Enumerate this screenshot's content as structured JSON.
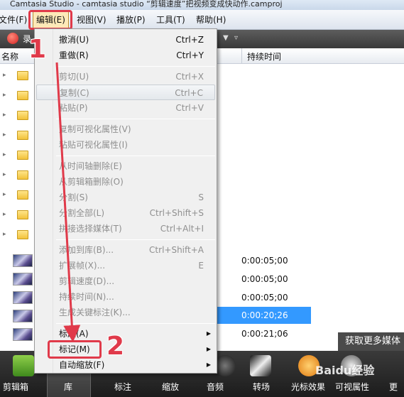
{
  "window": {
    "title": "Camtasia Studio - camtasia studio “剪辑速度”把视频变成快动作.camproj"
  },
  "menubar": {
    "file": "文件(F)",
    "edit": "编辑(E)",
    "view": "视图(V)",
    "play": "播放(P)",
    "tools": "工具(T)",
    "help": "帮助(H)"
  },
  "toolbar": {
    "record_label": "录"
  },
  "column_headers": {
    "name": "名称",
    "duration": "持续时间"
  },
  "clips": [
    {
      "duration": "0:00:05;00"
    },
    {
      "duration": "0:00:05;00"
    },
    {
      "duration": "0:00:05;00"
    },
    {
      "duration": "0:00:20;26"
    },
    {
      "duration": "0:00:21;06"
    }
  ],
  "edit_menu": {
    "undo": {
      "label": "撤消(U)",
      "shortcut": "Ctrl+Z"
    },
    "redo": {
      "label": "重做(R)",
      "shortcut": "Ctrl+Y"
    },
    "cut": {
      "label": "剪切(U)",
      "shortcut": "Ctrl+X"
    },
    "copy": {
      "label": "复制(C)",
      "shortcut": "Ctrl+C"
    },
    "paste": {
      "label": "粘贴(P)",
      "shortcut": "Ctrl+V"
    },
    "copy_visual": {
      "label": "复制可视化属性(V)"
    },
    "paste_visual": {
      "label": "粘贴可视化属性(I)"
    },
    "remove_timeline": {
      "label": "从时间轴删除(E)"
    },
    "remove_bin": {
      "label": "从剪辑箱删除(O)"
    },
    "split": {
      "label": "分割(S)",
      "shortcut": "S"
    },
    "split_all": {
      "label": "分割全部(L)",
      "shortcut": "Ctrl+Shift+S"
    },
    "stitch": {
      "label": "拼接选择媒体(T)",
      "shortcut": "Ctrl+Alt+I"
    },
    "add_library": {
      "label": "添加到库(B)...",
      "shortcut": "Ctrl+Shift+A"
    },
    "extend_frame": {
      "label": "扩展帧(X)...",
      "shortcut": "E"
    },
    "clip_speed": {
      "label": "剪辑速度(D)..."
    },
    "duration": {
      "label": "持续时间(N)..."
    },
    "keyframe": {
      "label": "生成关键标注(K)..."
    },
    "title": {
      "label": "标题(A)"
    },
    "marker": {
      "label": "标记(M)"
    },
    "autozoom": {
      "label": "自动缩放(F)"
    }
  },
  "get_more": "获取更多媒体",
  "bottom_tabs": {
    "clip_bin": "剪辑箱",
    "library": "库",
    "callouts": "标注",
    "zoom": "缩放",
    "audio": "音频",
    "transitions": "转场",
    "cursor_effects": "光标效果",
    "visual_props": "可视属性",
    "more": "更"
  },
  "annotations": {
    "step1": "1",
    "step2": "2"
  },
  "watermark": "Baidu经验",
  "colors": {
    "callout": "#e03a4a",
    "selection": "#3399ff",
    "menu_bg": "#f0f0f0"
  }
}
